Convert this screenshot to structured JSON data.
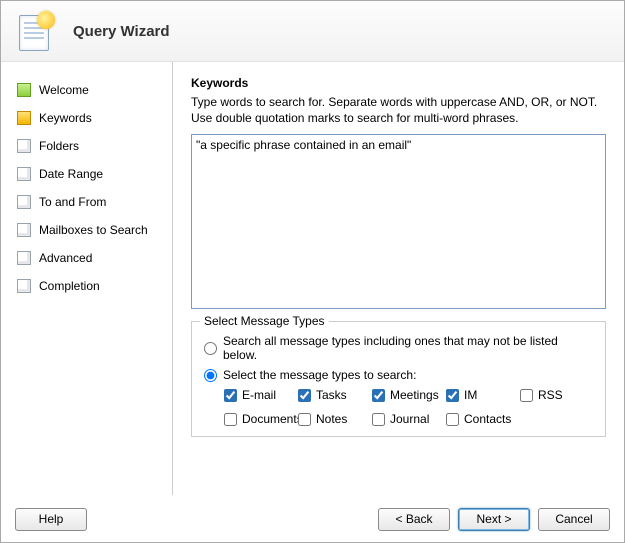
{
  "header": {
    "title": "Query Wizard"
  },
  "sidebar": {
    "items": [
      {
        "label": "Welcome",
        "state": "done"
      },
      {
        "label": "Keywords",
        "state": "active"
      },
      {
        "label": "Folders",
        "state": "pending"
      },
      {
        "label": "Date Range",
        "state": "pending"
      },
      {
        "label": "To and From",
        "state": "pending"
      },
      {
        "label": "Mailboxes to Search",
        "state": "pending"
      },
      {
        "label": "Advanced",
        "state": "pending"
      },
      {
        "label": "Completion",
        "state": "pending"
      }
    ]
  },
  "main": {
    "title": "Keywords",
    "description": "Type words to search for. Separate words with uppercase AND, OR, or NOT. Use double quotation marks to search for multi-word phrases.",
    "keywords_value": "\"a specific phrase contained in an email\"",
    "fieldset_legend": "Select Message Types",
    "radio_all_label": "Search all message types including ones that may not be listed below.",
    "radio_select_label": "Select the message types to search:",
    "radio_selected": "select",
    "types": [
      {
        "label": "E-mail",
        "checked": true
      },
      {
        "label": "Tasks",
        "checked": true
      },
      {
        "label": "Meetings",
        "checked": true
      },
      {
        "label": "IM",
        "checked": true
      },
      {
        "label": "RSS",
        "checked": false
      },
      {
        "label": "Documents",
        "checked": false
      },
      {
        "label": "Notes",
        "checked": false
      },
      {
        "label": "Journal",
        "checked": false
      },
      {
        "label": "Contacts",
        "checked": false
      }
    ]
  },
  "footer": {
    "help": "Help",
    "back": "< Back",
    "next": "Next >",
    "cancel": "Cancel"
  }
}
